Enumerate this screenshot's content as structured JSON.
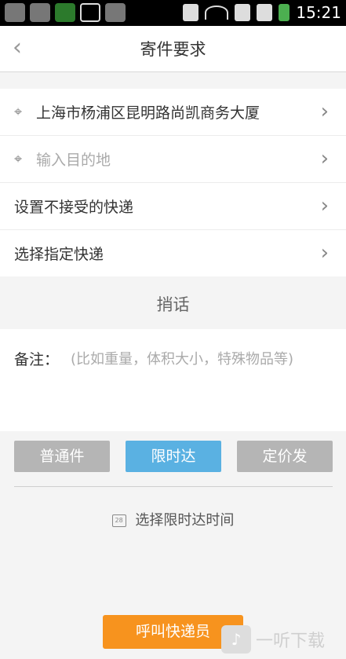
{
  "status_bar": {
    "time": "15:21"
  },
  "header": {
    "title": "寄件要求"
  },
  "list": {
    "origin": "上海市杨浦区昆明路尚凯商务大厦",
    "destination_placeholder": "输入目的地",
    "exclude_courier": "设置不接受的快递",
    "select_courier": "选择指定快递"
  },
  "message": {
    "title": "捎话"
  },
  "notes": {
    "label": "备注：",
    "placeholder": "(比如重量，体积大小，特殊物品等)"
  },
  "tabs": [
    {
      "label": "普通件"
    },
    {
      "label": "限时达",
      "active": true
    },
    {
      "label": "定价发"
    }
  ],
  "time_select": {
    "label": "选择限时达时间",
    "calendar_day": "28"
  },
  "call_button": "呼叫快递员",
  "watermark": {
    "text": "一听下载"
  },
  "colors": {
    "accent": "#5ab1e2",
    "call": "#f7931e",
    "tab_inactive": "#b5b5b5"
  }
}
